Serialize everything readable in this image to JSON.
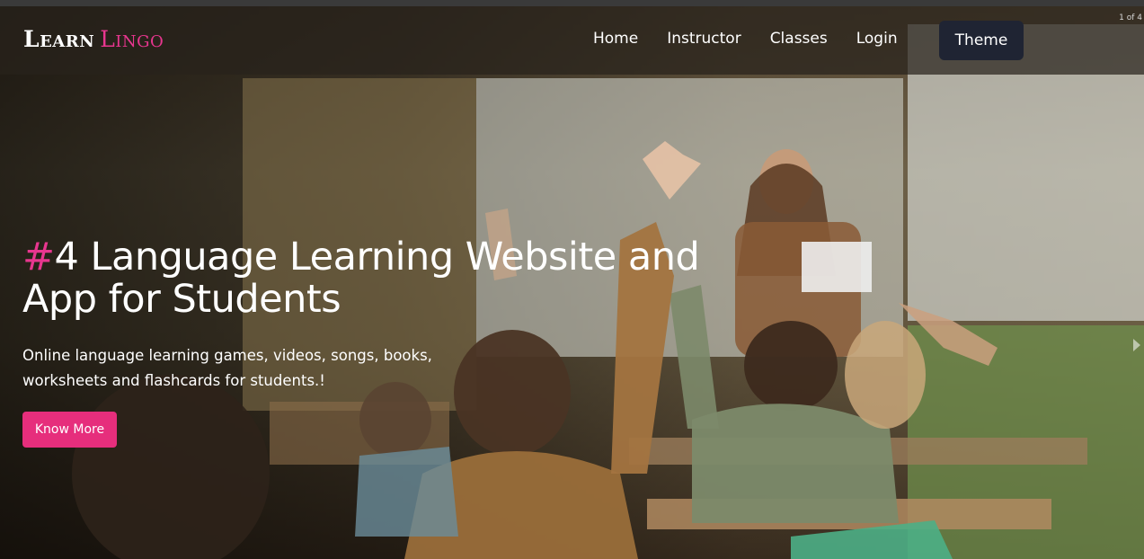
{
  "brand": {
    "word1": "Learn",
    "word2": "Lingo",
    "accent_color": "#e8368f"
  },
  "nav": {
    "items": [
      {
        "label": "Home"
      },
      {
        "label": "Instructor"
      },
      {
        "label": "Classes"
      },
      {
        "label": "Login"
      }
    ],
    "theme_label": "Theme",
    "theme_bg": "#1f2433"
  },
  "slider": {
    "pager_text": "1 of 4",
    "next_icon": "chevron-right-icon"
  },
  "hero": {
    "hash": "#",
    "headline": "4 Language Learning Website and App for Students",
    "subtext": "Online language learning games, videos, songs, books, worksheets and flashcards for students.!",
    "cta_label": "Know More",
    "cta_color": "#e62e7c",
    "background_image": "classroom-photo"
  }
}
